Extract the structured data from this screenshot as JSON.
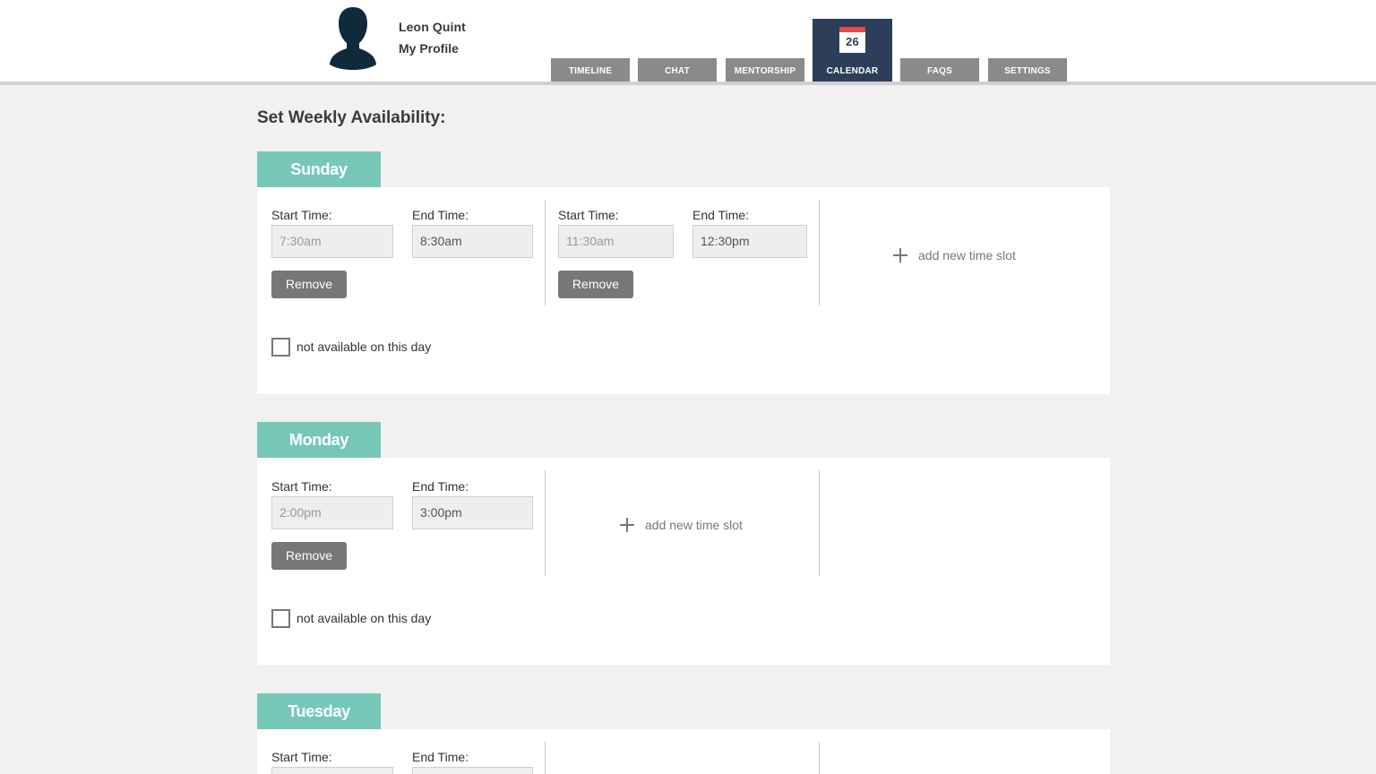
{
  "user": {
    "name": "Leon Quint",
    "profile_link": "My Profile"
  },
  "nav": {
    "tabs": [
      "TIMELINE",
      "CHAT",
      "MENTORSHIP",
      "CALENDAR",
      "FAQS",
      "SETTINGS"
    ],
    "active": "CALENDAR",
    "calendar_day": "26"
  },
  "page": {
    "title": "Set Weekly Availability:"
  },
  "labels": {
    "start_time": "Start Time:",
    "end_time": "End Time:",
    "remove": "Remove",
    "add_slot": "add new time slot",
    "not_available": "not available on this day"
  },
  "days": [
    {
      "name": "Sunday",
      "slots": [
        {
          "start": "7:30am",
          "end": "8:30am"
        },
        {
          "start": "11:30am",
          "end": "12:30pm"
        }
      ]
    },
    {
      "name": "Monday",
      "slots": [
        {
          "start": "2:00pm",
          "end": "3:00pm"
        }
      ]
    },
    {
      "name": "Tuesday",
      "slots": [
        {
          "start": "",
          "end": ""
        }
      ]
    }
  ],
  "colors": {
    "day_tab": "#77c7b9",
    "active_tab": "#2c3e5a",
    "tab": "#8a8a8a",
    "calendar_accent": "#e84b44"
  }
}
